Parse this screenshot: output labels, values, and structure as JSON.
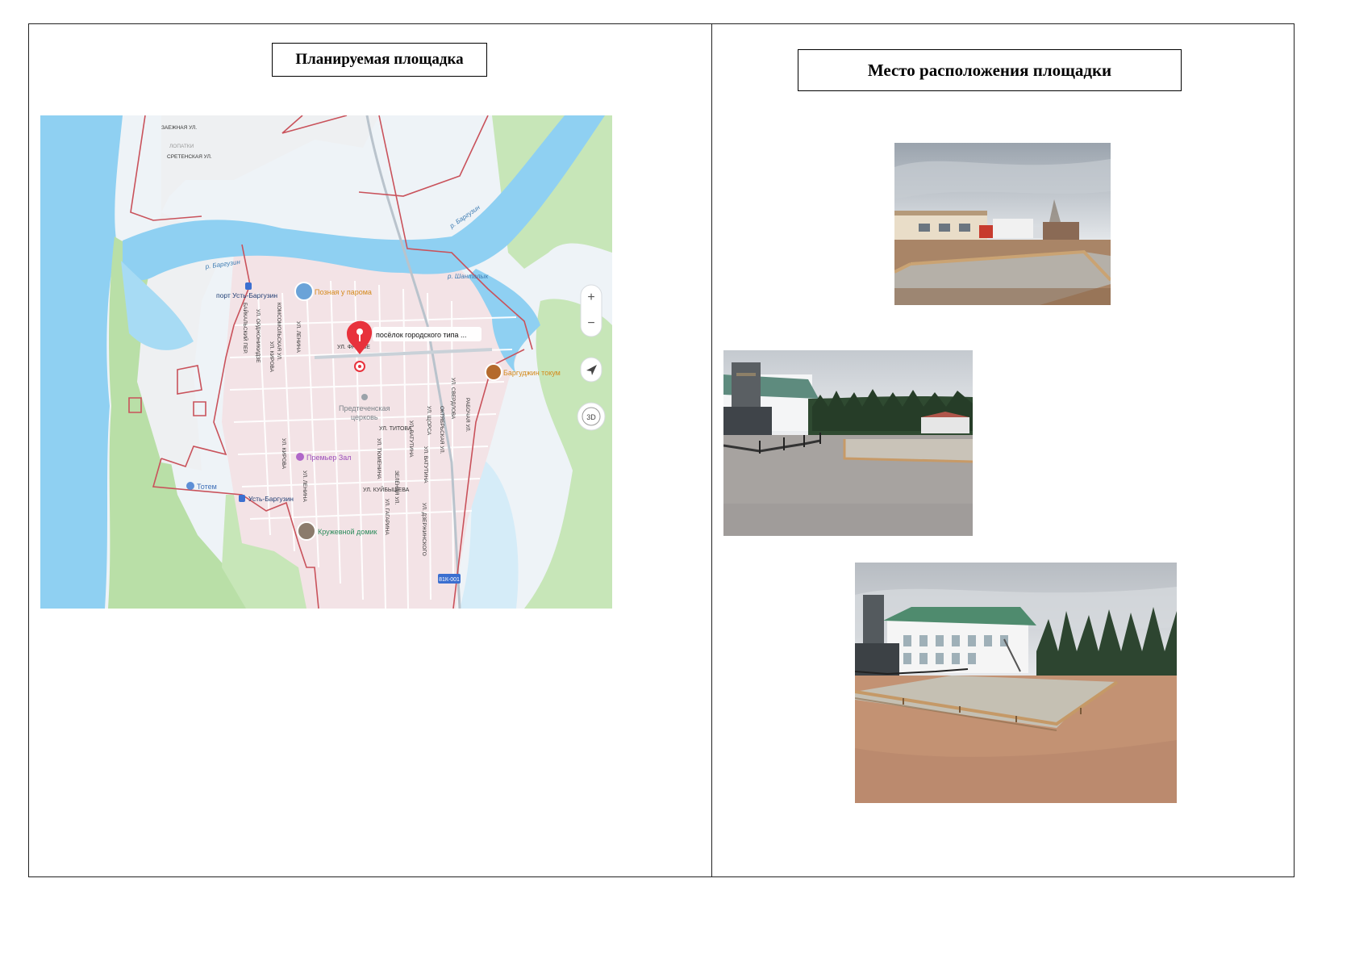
{
  "left_panel": {
    "title": "Планируемая площадка",
    "map": {
      "labels": {
        "street_zaezhnaya": "ЗАЕЖНАЯ УЛ.",
        "street_sretenskaya": "СРЕТЕНСКАЯ УЛ.",
        "area_lopatki": "ЛОПАТКИ",
        "river_barguzin_1": "р. Баргузин",
        "river_barguzin_2": "р. Баргузин",
        "river_shantalyk": "р. Шанталык",
        "port": "порт Усть-Баргузин",
        "poznaya": "Позная у парома",
        "pin_label": "посёлок городского типа ...",
        "barguzhin_tokum": "Баргуджин токум",
        "church_line1": "Предтеченская",
        "church_line2": "церковь",
        "premier_zal": "Премьер Зал",
        "totem": "Тотем",
        "ust_barguzin": "Усть-Баргузин",
        "kruzhevnoy": "Кружевной домик",
        "street_frunze": "УЛ. ФРУНЗЕ",
        "street_titova": "УЛ. ТИТОВА",
        "street_kuibysheva": "УЛ. КУЙБЫШЕВА",
        "street_lenina": "УЛ. ЛЕНИНА",
        "street_kirova": "УЛ. КИРОВА",
        "street_komsomolskaya": "КОМСОМОЛЬСКАЯ УЛ.",
        "street_baikalsky": "БАЙКАЛЬСКИЙ ПЕР.",
        "street_ordzhonikidze": "УЛ. ОРДЖОНИКИДЗЕ",
        "street_tyumenina": "УЛ. ТЮМЕНИНА",
        "street_zelenaya": "ЗЕЛЁНАЯ УЛ.",
        "street_gagarina": "УЛ. ГАГАРИНА",
        "street_vatutina": "УЛ. ВАТУТИНА",
        "street_sverdlova": "УЛ. СВЕРДЛОВА",
        "street_rabochaya": "РАБОЧАЯ УЛ.",
        "street_dzerzhinskogo": "УЛ. ДЗЕРЖИНСКОГО",
        "street_shchorsa": "УЛ. ЩОРСА",
        "street_oktyabrskaya": "ОКТЯБРЬСКАЯ УЛ.",
        "road_sign": "81К-001"
      },
      "controls": {
        "zoom_in": "+",
        "zoom_out": "−",
        "view_3d": "3D"
      },
      "icons": [
        "location-pin-icon",
        "compass-arrow-icon",
        "bus-stop-icon",
        "church-icon"
      ]
    }
  },
  "right_panel": {
    "title": "Место расположения площадки",
    "photos": [
      {
        "subject": "concrete-slab-near-building-photo"
      },
      {
        "subject": "site-near-memorial-photo"
      },
      {
        "subject": "foundation-frame-near-white-building-photo"
      }
    ]
  },
  "colors": {
    "water": "#8fd0f2",
    "land": "#f3e3e6",
    "forest": "#b9dfa7",
    "boundary": "#c9525b",
    "pin": "#e8323c"
  }
}
